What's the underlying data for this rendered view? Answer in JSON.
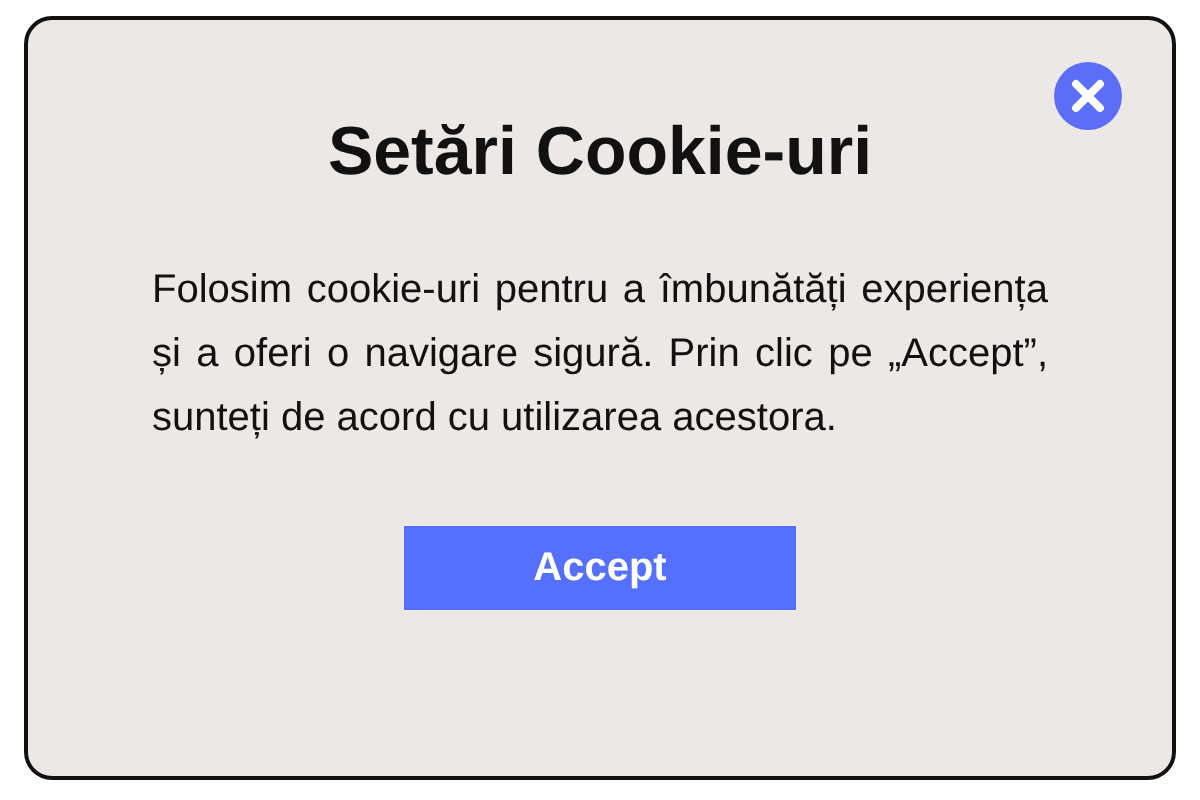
{
  "dialog": {
    "title": "Setări Cookie-uri",
    "message": "Folosim cookie-uri pentru a îmbunătăți experiența și a oferi o navigare sigură. Prin clic pe „Accept”, sunteți de acord cu utilizarea acestora.",
    "buttons": [
      "Accept"
    ]
  }
}
